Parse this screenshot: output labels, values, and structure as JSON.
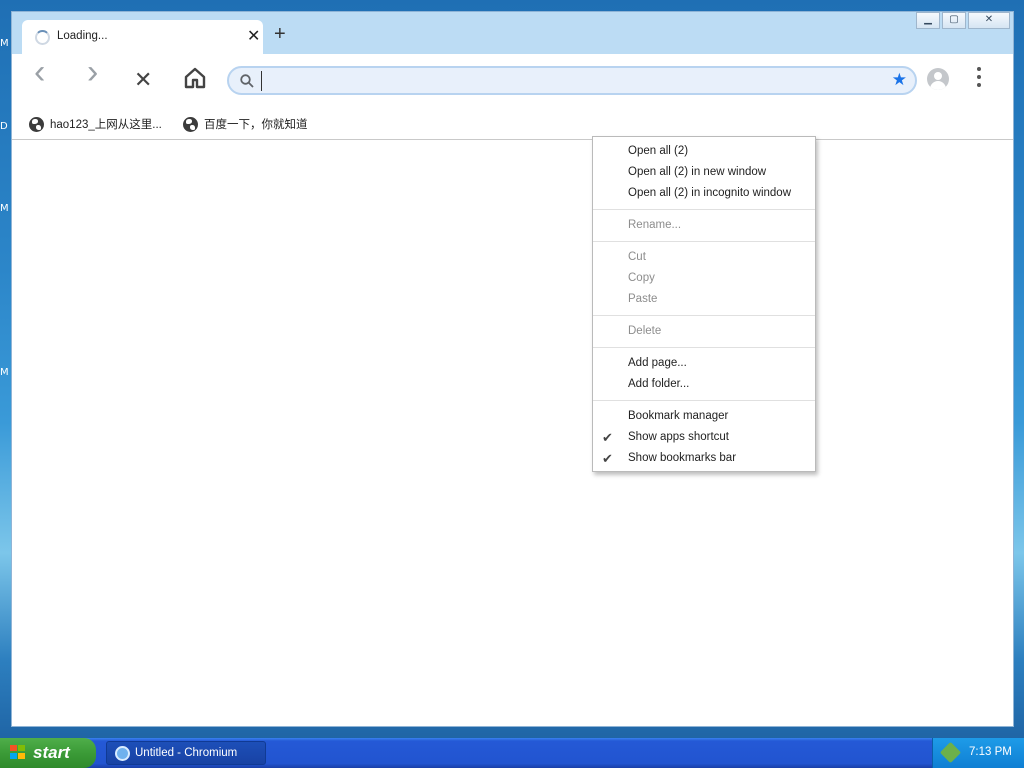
{
  "desktop": {
    "edge_fragments": [
      "M",
      "D",
      "M",
      "M"
    ]
  },
  "window": {
    "controls": {
      "minimize": "▁",
      "maximize": "▢",
      "close": "✕"
    },
    "tab": {
      "title": "Loading...",
      "close_icon": "✕",
      "new_tab_icon": "+"
    },
    "toolbar": {
      "back_icon": "‹",
      "forward_icon": "›",
      "stop_icon": "✕",
      "omnibox_value": "",
      "omnibox_placeholder": "",
      "star_icon": "★"
    },
    "bookmarks": [
      {
        "label": "hao123_上网从这里..."
      },
      {
        "label": "百度一下，你就知道"
      }
    ]
  },
  "context_menu": {
    "groups": [
      [
        {
          "label": "Open all (2)",
          "disabled": false,
          "checked": false
        },
        {
          "label": "Open all (2) in new window",
          "disabled": false,
          "checked": false
        },
        {
          "label": "Open all (2) in incognito window",
          "disabled": false,
          "checked": false
        }
      ],
      [
        {
          "label": "Rename...",
          "disabled": true,
          "checked": false
        }
      ],
      [
        {
          "label": "Cut",
          "disabled": true,
          "checked": false
        },
        {
          "label": "Copy",
          "disabled": true,
          "checked": false
        },
        {
          "label": "Paste",
          "disabled": true,
          "checked": false
        }
      ],
      [
        {
          "label": "Delete",
          "disabled": true,
          "checked": false
        }
      ],
      [
        {
          "label": "Add page...",
          "disabled": false,
          "checked": false
        },
        {
          "label": "Add folder...",
          "disabled": false,
          "checked": false
        }
      ],
      [
        {
          "label": "Bookmark manager",
          "disabled": false,
          "checked": false
        },
        {
          "label": "Show apps shortcut",
          "disabled": false,
          "checked": true
        },
        {
          "label": "Show bookmarks bar",
          "disabled": false,
          "checked": true
        }
      ]
    ],
    "check_glyph": "✔"
  },
  "taskbar": {
    "start_label": "start",
    "task_label": "Untitled - Chromium",
    "clock": "7:13 PM"
  },
  "colors": {
    "accent": "#1a73e8",
    "tabstrip": "#bcdcf4",
    "taskbar": "#2254d0",
    "start_button": "#3b9b37"
  }
}
